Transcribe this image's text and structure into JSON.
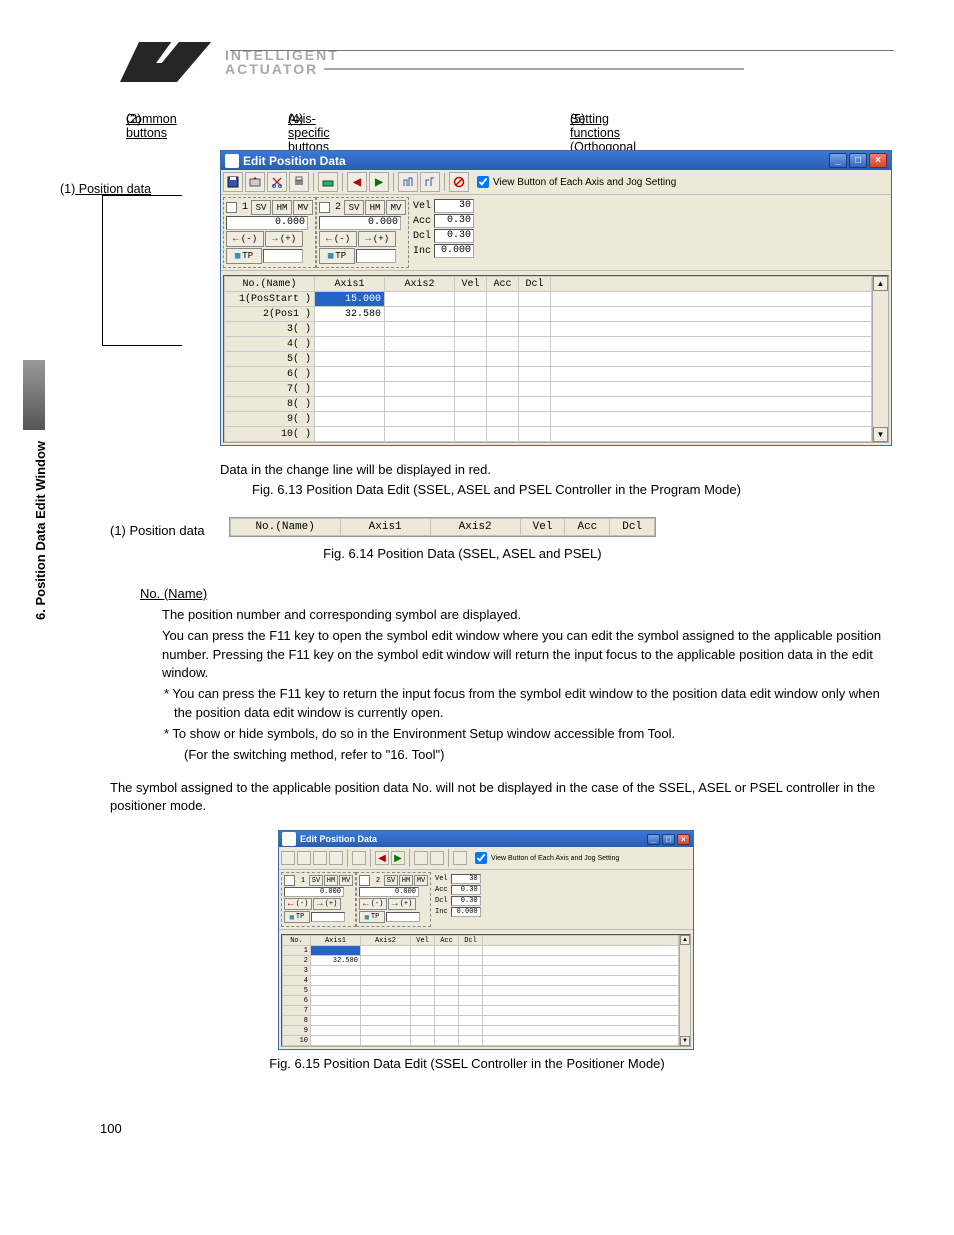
{
  "brand": {
    "line1": "INTELLIGENT",
    "line2": "ACTUATOR"
  },
  "sidetab": "6. Position Data Edit Window",
  "callouts": {
    "c2": "(2)",
    "c2_text": " Common buttons",
    "c4": "(4)",
    "c4_text": " Axis-specific buttons (Orthogonal axis)",
    "c5": "(5)",
    "c5_text": " Setting functions (Orthogonal axis)",
    "c1": "(1)",
    "c1_text": " Position data"
  },
  "win": {
    "title": "Edit Position Data",
    "checkbox": "View Button of Each Axis and Jog Setting",
    "axis": {
      "sv": "SV",
      "hm": "HM",
      "mv": "MV",
      "minus": "(-)",
      "plus": "(+)",
      "tp": "TP",
      "a1_num": "1",
      "a2_num": "2",
      "a1_val": "0.000",
      "a2_val": "0.000"
    },
    "setting": {
      "vel_l": "Vel",
      "vel_v": "30",
      "acc_l": "Acc",
      "acc_v": "0.30",
      "dcl_l": "Dcl",
      "dcl_v": "0.30",
      "inc_l": "Inc",
      "inc_v": "0.000"
    },
    "gridhdr": {
      "no": "No.(Name)",
      "no_short": "No.",
      "a1": "Axis1",
      "a2": "Axis2",
      "vel": "Vel",
      "acc": "Acc",
      "dcl": "Dcl"
    },
    "rows": [
      {
        "n": "1",
        "name": "(PosStart )",
        "a1": "15.000",
        "a1_red": true,
        "sel": true
      },
      {
        "n": "2",
        "name": "(Pos1     )",
        "a1": "32.580"
      },
      {
        "n": "3",
        "name": "(         )"
      },
      {
        "n": "4",
        "name": "(         )"
      },
      {
        "n": "5",
        "name": "(         )"
      },
      {
        "n": "6",
        "name": "(         )"
      },
      {
        "n": "7",
        "name": "(         )"
      },
      {
        "n": "8",
        "name": "(         )"
      },
      {
        "n": "9",
        "name": "(         )"
      },
      {
        "n": "10",
        "name": "(         )"
      }
    ],
    "rows_sm": [
      {
        "n": "1",
        "sel": true
      },
      {
        "n": "2",
        "a1": "32.580"
      },
      {
        "n": "3"
      },
      {
        "n": "4"
      },
      {
        "n": "5"
      },
      {
        "n": "6"
      },
      {
        "n": "7"
      },
      {
        "n": "8"
      },
      {
        "n": "9"
      },
      {
        "n": "10"
      }
    ]
  },
  "captions": {
    "redline": "Data in the change line will be displayed in red.",
    "fig613": "Fig. 6.13 Position Data Edit (SSEL, ASEL and PSEL Controller in the Program Mode)",
    "fig614_lbl": "(1) Position data",
    "fig614": "Fig. 6.14 Position Data (SSEL, ASEL and PSEL)",
    "fig615": "Fig. 6.15 Position Data Edit (SSEL Controller in the Positioner Mode)"
  },
  "body": {
    "h": "No. (Name)",
    "p1": "The position number and corresponding symbol are displayed.",
    "p2": "You can press the F11 key to open the symbol edit window where you can edit the symbol assigned to the applicable position number. Pressing the F11 key on the symbol edit window will return the input focus to the applicable position data in the edit window.",
    "p3": "* You can press the F11 key to return the input focus from the symbol edit window to the position data edit window only when the position data edit window is currently open.",
    "p4": "* To show or hide symbols, do so in the Environment Setup window accessible from Tool.",
    "p5": "(For the switching method, refer to \"16. Tool\")",
    "para2": "The symbol assigned to the applicable position data No. will not be displayed in the case of the SSEL, ASEL or PSEL controller in the positioner mode."
  },
  "pagenum": "100"
}
